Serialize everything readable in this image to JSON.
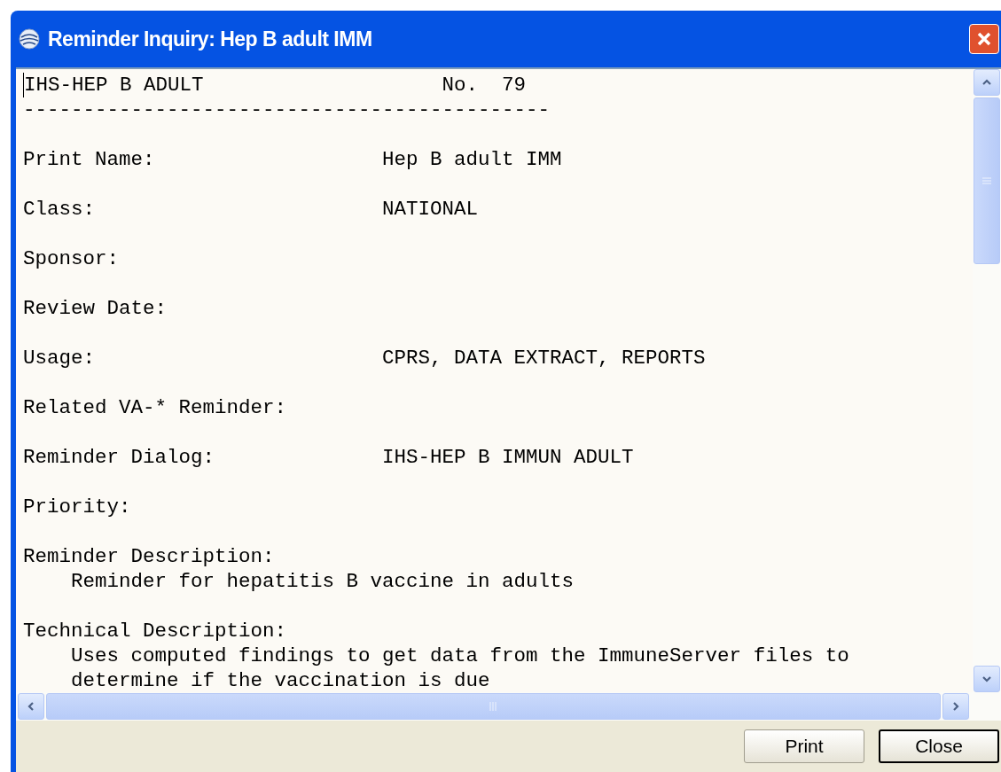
{
  "window": {
    "title": "Reminder Inquiry: Hep B adult IMM"
  },
  "report": {
    "name": "IHS-HEP B ADULT",
    "number_label": "No.",
    "number": "79",
    "rule": "--------------------------------------------",
    "entries": [
      {
        "kind": "field",
        "label": "Print Name:",
        "value": "Hep B adult IMM"
      },
      {
        "kind": "field",
        "label": "Class:",
        "value": "NATIONAL"
      },
      {
        "kind": "field",
        "label": "Sponsor:"
      },
      {
        "kind": "field",
        "label": "Review Date:"
      },
      {
        "kind": "field",
        "label": "Usage:",
        "value": "CPRS, DATA EXTRACT, REPORTS"
      },
      {
        "kind": "field",
        "label": "Related VA-* Reminder:"
      },
      {
        "kind": "field",
        "label": "Reminder Dialog:",
        "value": "IHS-HEP B IMMUN ADULT"
      },
      {
        "kind": "field",
        "label": "Priority:"
      },
      {
        "kind": "description",
        "label": "Reminder Description:",
        "lines": [
          "Reminder for hepatitis B vaccine in adults"
        ]
      },
      {
        "kind": "description",
        "label": "Technical Description:",
        "lines": [
          "Uses computed findings to get data from the ImmuneServer files to",
          "determine if the vaccination is due"
        ]
      }
    ]
  },
  "buttons": [
    {
      "label": "Print",
      "default": false
    },
    {
      "label": "Close",
      "default": true
    }
  ]
}
